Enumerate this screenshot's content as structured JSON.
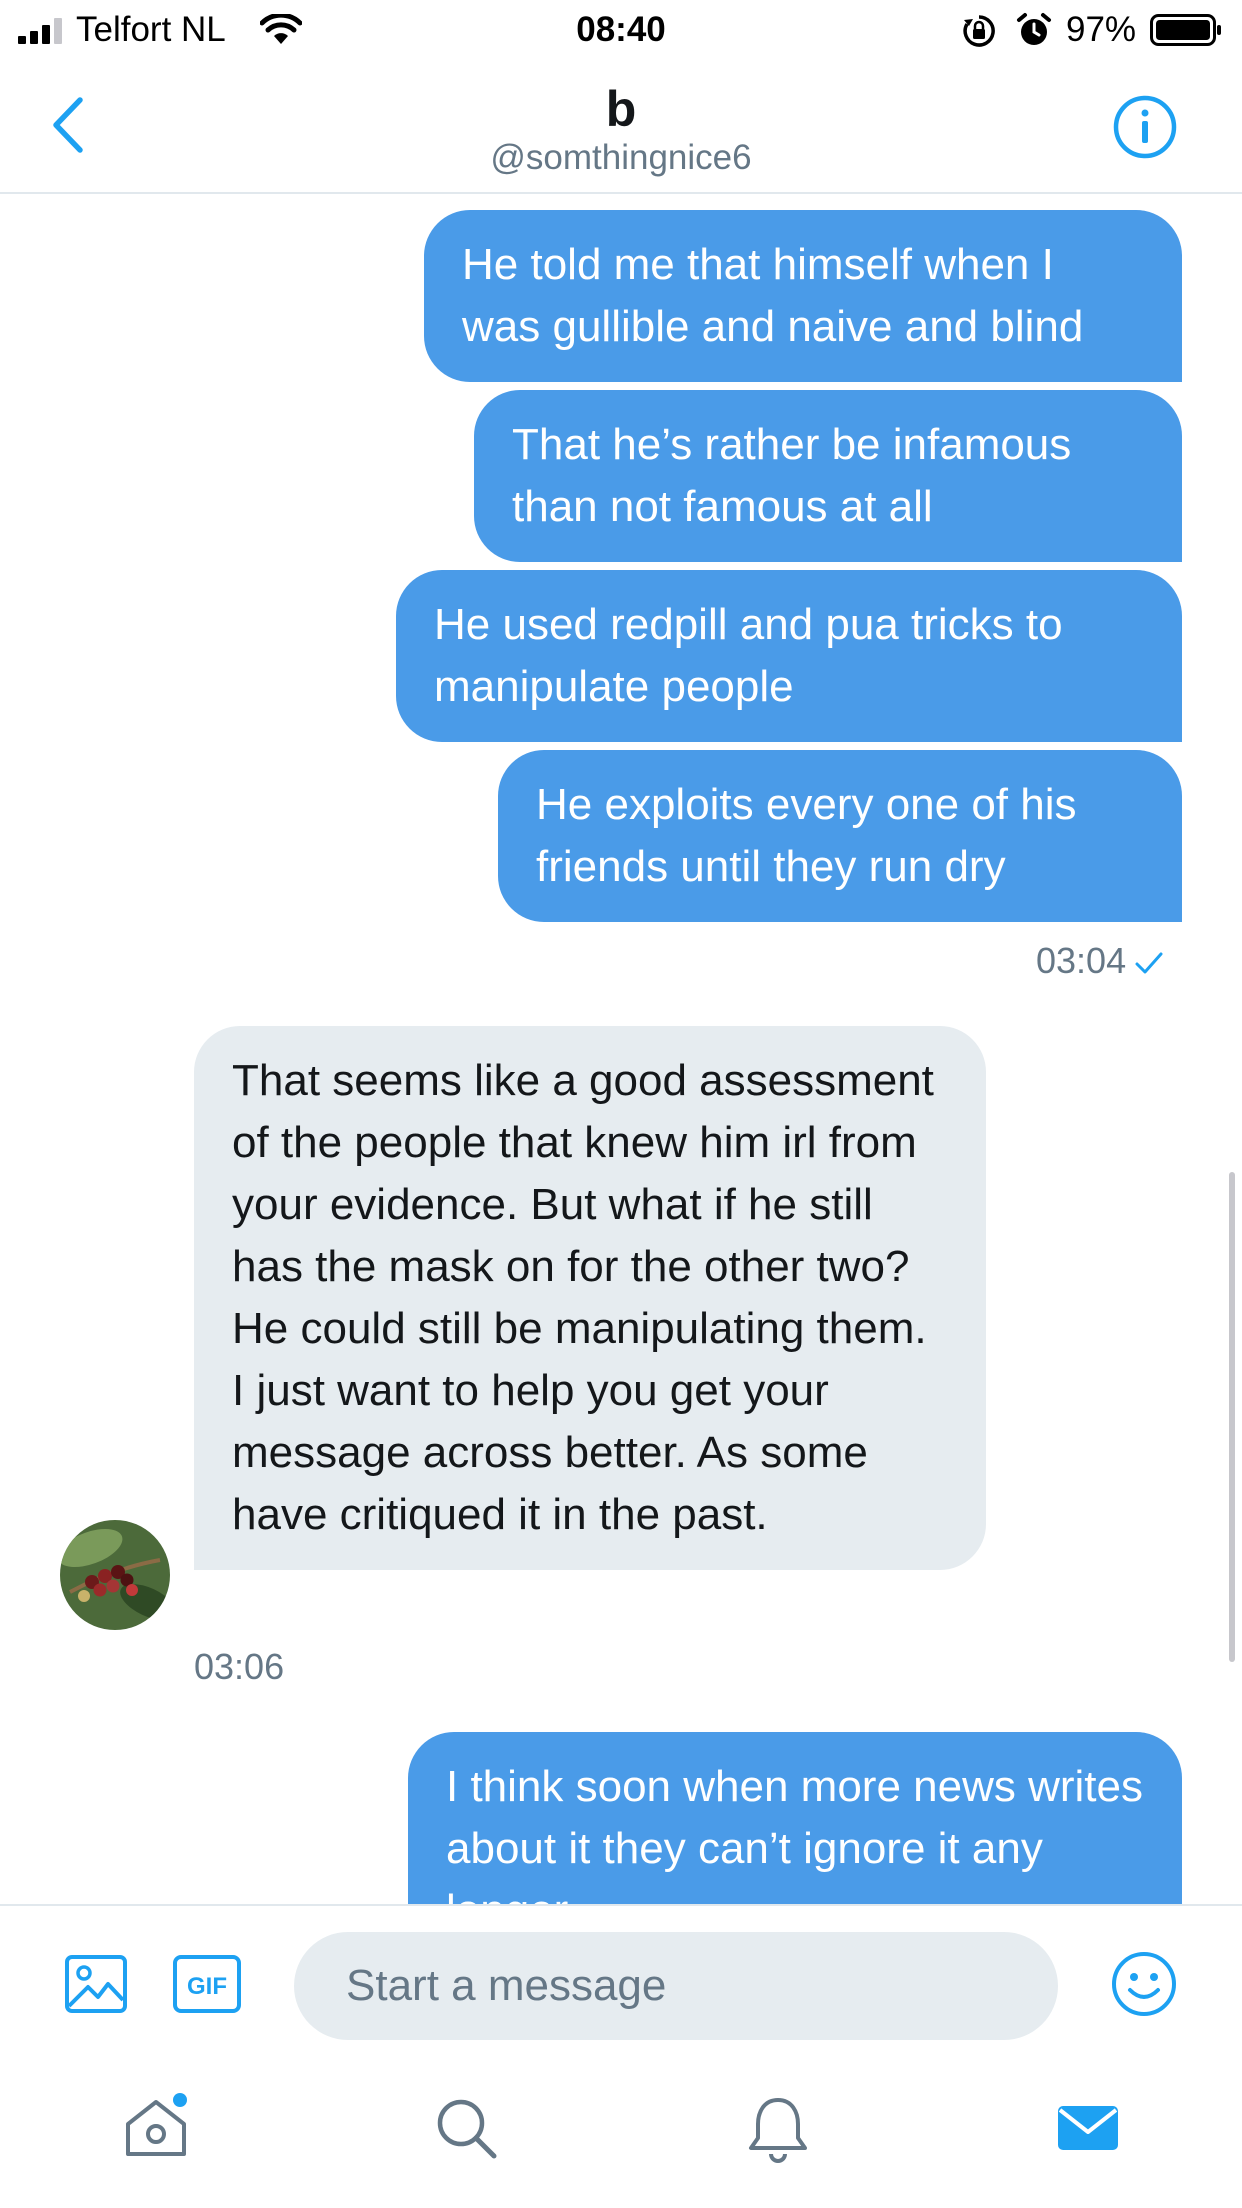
{
  "status_bar": {
    "carrier": "Telfort NL",
    "time": "08:40",
    "battery": "97%"
  },
  "header": {
    "title": "b",
    "handle": "@somthingnice6"
  },
  "messages": [
    {
      "direction": "out",
      "text": "He told me that himself when I was gullible and naive and blind"
    },
    {
      "direction": "out",
      "text": "That he’s rather be infamous than not famous at all"
    },
    {
      "direction": "out",
      "text": "He used redpill and pua tricks to manipulate people"
    },
    {
      "direction": "out",
      "text": "He exploits every one of his friends until they run dry"
    },
    {
      "direction": "in",
      "text": "That seems like a good assessment of the people that knew him irl from your evidence. But what if he still has the mask on for the other two? He could still be manipulating them. I just want to help you get your message across better. As some have critiqued it in the past."
    },
    {
      "direction": "out",
      "text": "I think soon when more news writes about it they can’t ignore it any longer"
    }
  ],
  "timestamps": {
    "sent": "03:04",
    "received": "03:06"
  },
  "composer": {
    "placeholder": "Start a message"
  },
  "icons": {
    "accent": "#1da1f2",
    "sent_bubble": "#4a9be8",
    "received_bubble": "#e6ecf0",
    "tab_icons": [
      "home-icon",
      "search-icon",
      "notifications-icon",
      "messages-icon"
    ]
  }
}
